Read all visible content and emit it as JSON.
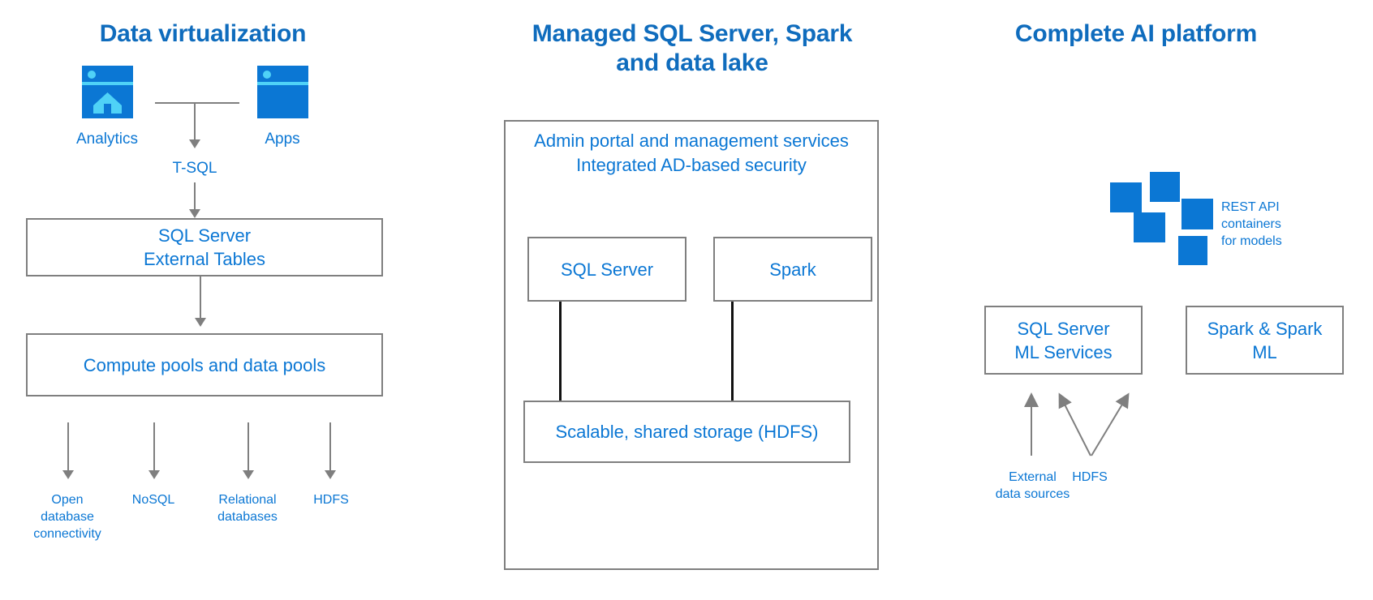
{
  "colors": {
    "title_blue": "#0f6cbd",
    "text_blue": "#0b77d4",
    "icon_blue": "#0b77d4",
    "icon_accent": "#4fd2f7",
    "box_border": "#7f7f7f",
    "connector_black": "#111111",
    "background": "#ffffff"
  },
  "columns": [
    {
      "id": "data-virtualization",
      "title": "Data virtualization",
      "icons": [
        {
          "name": "analytics-window-icon",
          "label": "Analytics"
        },
        {
          "name": "apps-window-icon",
          "label": "Apps"
        }
      ],
      "connector_label": "T-SQL",
      "boxes": [
        {
          "name": "sql-server-external-tables-box",
          "lines": [
            "SQL Server",
            "External Tables"
          ]
        },
        {
          "name": "compute-data-pools-box",
          "lines": [
            "Compute pools and data pools"
          ]
        }
      ],
      "sources": [
        {
          "name": "source-odbc",
          "lines": [
            "Open",
            "database",
            "connectivity"
          ]
        },
        {
          "name": "source-nosql",
          "lines": [
            "NoSQL"
          ]
        },
        {
          "name": "source-relational",
          "lines": [
            "Relational",
            "databases"
          ]
        },
        {
          "name": "source-hdfs",
          "lines": [
            "HDFS"
          ]
        }
      ]
    },
    {
      "id": "managed-sql-spark-datalake",
      "title_lines": [
        "Managed SQL Server, Spark",
        "and data lake"
      ],
      "header_lines": [
        "Admin portal and management services",
        "Integrated AD-based security"
      ],
      "boxes": [
        {
          "name": "sql-server-box",
          "lines": [
            "SQL Server"
          ]
        },
        {
          "name": "spark-box",
          "lines": [
            "Spark"
          ]
        },
        {
          "name": "shared-storage-box",
          "lines": [
            "Scalable, shared storage (HDFS)"
          ]
        }
      ]
    },
    {
      "id": "complete-ai-platform",
      "title": "Complete AI platform",
      "cluster_label_lines": [
        "REST API",
        "containers",
        "for models"
      ],
      "boxes": [
        {
          "name": "sql-server-ml-services-box",
          "lines": [
            "SQL Server",
            "ML Services"
          ]
        },
        {
          "name": "spark-and-spark-ml-box",
          "lines": [
            "Spark & Spark",
            "ML"
          ]
        }
      ],
      "sources": [
        {
          "name": "source-external-data",
          "lines": [
            "External",
            "data sources"
          ]
        },
        {
          "name": "source-hdfs",
          "lines": [
            "HDFS"
          ]
        }
      ]
    }
  ]
}
